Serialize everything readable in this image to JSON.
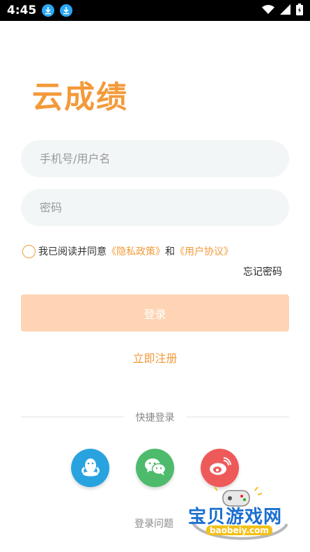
{
  "status_bar": {
    "time": "4:45"
  },
  "app": {
    "logo": "云成绩"
  },
  "form": {
    "username_placeholder": "手机号/用户名",
    "password_placeholder": "密码"
  },
  "agreement": {
    "prefix": "我已阅读并同意",
    "privacy": "《隐私政策》",
    "and": "和",
    "terms": "《用户协议》"
  },
  "forgot_password": "忘记密码",
  "login_button": "登录",
  "register_link": "立即注册",
  "quick_login_label": "快捷登录",
  "login_problem": "登录问题",
  "watermark": {
    "text": "宝贝游戏网",
    "url": "baobeiy.com"
  },
  "colors": {
    "accent": "#f39a3a",
    "login_button": "#fed4b4",
    "qq": "#29a3e0",
    "wechat": "#4dbb6b",
    "weibo": "#ee5a5a"
  }
}
